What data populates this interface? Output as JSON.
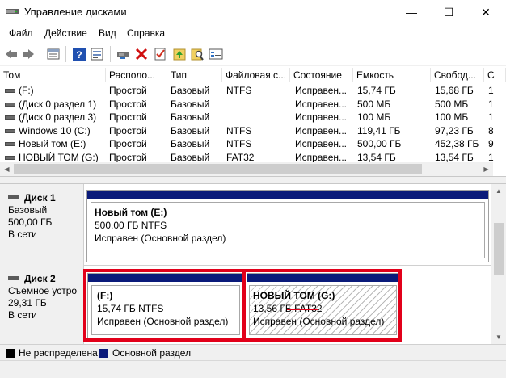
{
  "window": {
    "title": "Управление дисками",
    "minimize": "—",
    "maximize": "☐",
    "close": "✕"
  },
  "menu": [
    "Файл",
    "Действие",
    "Вид",
    "Справка"
  ],
  "toolbar": [
    "back-icon",
    "forward-icon",
    "view-list-icon",
    "help-icon",
    "properties-icon",
    "connect-icon",
    "delete-icon",
    "check-icon",
    "up-icon",
    "search-icon",
    "settings-icon"
  ],
  "table": {
    "headers": [
      "Том",
      "Располо...",
      "Тип",
      "Файловая с...",
      "Состояние",
      "Емкость",
      "Свобод...",
      "С"
    ],
    "rows": [
      [
        "(F:)",
        "Простой",
        "Базовый",
        "NTFS",
        "Исправен...",
        "15,74 ГБ",
        "15,68 ГБ",
        "1"
      ],
      [
        "(Диск 0 раздел 1)",
        "Простой",
        "Базовый",
        "",
        "Исправен...",
        "500 МБ",
        "500 МБ",
        "1"
      ],
      [
        "(Диск 0 раздел 3)",
        "Простой",
        "Базовый",
        "",
        "Исправен...",
        "100 МБ",
        "100 МБ",
        "1"
      ],
      [
        "Windows 10 (C:)",
        "Простой",
        "Базовый",
        "NTFS",
        "Исправен...",
        "119,41 ГБ",
        "97,23 ГБ",
        "8"
      ],
      [
        "Новый том (E:)",
        "Простой",
        "Базовый",
        "NTFS",
        "Исправен...",
        "500,00 ГБ",
        "452,38 ГБ",
        "9"
      ],
      [
        "НОВЫЙ ТОМ (G:)",
        "Простой",
        "Базовый",
        "FAT32",
        "Исправен...",
        "13,54 ГБ",
        "13,54 ГБ",
        "1"
      ]
    ]
  },
  "disks": [
    {
      "name": "Диск 1",
      "type": "Базовый",
      "size": "500,00 ГБ",
      "status": "В сети",
      "partitions": [
        {
          "name": "Новый том  (E:)",
          "size": "500,00 ГБ NTFS",
          "status": "Исправен (Основной раздел)"
        }
      ]
    },
    {
      "name": "Диск 2",
      "type": "Съемное устро",
      "size": "29,31 ГБ",
      "status": "В сети",
      "partitions": [
        {
          "name": "(F:)",
          "size": "15,74 ГБ NTFS",
          "status": "Исправен (Основной раздел)"
        },
        {
          "name": "НОВЫЙ ТОМ  (G:)",
          "size_prefix": "13,56 ГБ ",
          "fs": "FAT32",
          "status": "Исправен (Основной раздел)"
        }
      ]
    }
  ],
  "legend": [
    {
      "label": "Не распределена",
      "color": "#000000"
    },
    {
      "label": "Основной раздел",
      "color": "#0a1a7a"
    }
  ],
  "colors": {
    "primary_partition": "#0a1a7a",
    "highlight": "#e2001a",
    "unallocated": "#000000"
  }
}
